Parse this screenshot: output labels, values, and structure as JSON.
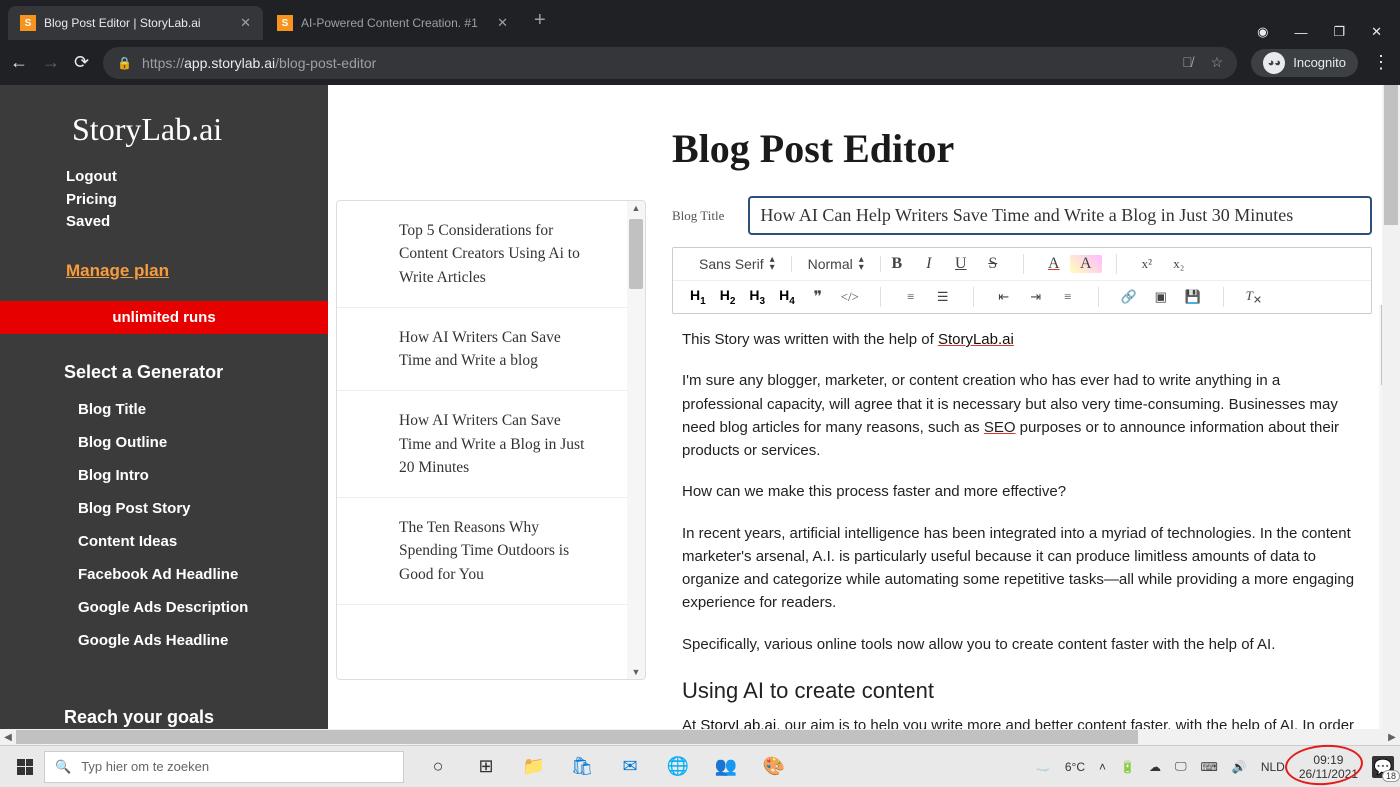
{
  "browser": {
    "tabs": [
      {
        "label": "Blog Post Editor | StoryLab.ai",
        "active": true
      },
      {
        "label": "AI-Powered Content Creation. #1",
        "active": false
      }
    ],
    "url_prefix": "https://",
    "url_host": "app.storylab.ai",
    "url_path": "/blog-post-editor",
    "incognito": "Incognito"
  },
  "sidebar": {
    "logo": "StoryLab.ai",
    "links": [
      "Logout",
      "Pricing",
      "Saved"
    ],
    "manage": "Manage plan",
    "banner": "unlimited runs",
    "gen_head": "Select a Generator",
    "generators": [
      "Blog Title",
      "Blog Outline",
      "Blog Intro",
      "Blog Post Story",
      "Content Ideas",
      "Facebook Ad Headline",
      "Google Ads Description",
      "Google Ads Headline"
    ],
    "goals": "Reach your goals"
  },
  "suggestions": [
    "Top 5 Considerations for Content Creators Using Ai to Write Articles",
    "How AI Writers Can Save Time and Write a blog",
    "How AI Writers Can Save Time and Write a Blog in Just 20 Minutes",
    "The Ten Reasons Why Spending Time Outdoors is Good for You"
  ],
  "editor": {
    "page_title": "Blog Post Editor",
    "title_label": "Blog Title",
    "title_value": "How AI Can Help Writers Save Time and Write a Blog in Just 30 Minutes",
    "font_family": "Sans Serif",
    "font_size": "Normal",
    "body": {
      "intro_prefix": "This Story was written with the help of ",
      "intro_link": "StoryLab.ai",
      "p1a": "I'm sure any blogger, marketer, or content creation who has ever had to write anything in a professional capacity, will agree that it is necessary but also very time-consuming. Businesses may need blog articles for many reasons, such as ",
      "p1_seo": "SEO",
      "p1b": " purposes or to announce information about their products or services.",
      "p2": "How can we make this process faster and more effective?",
      "p3": "In recent years, artificial intelligence has been integrated into a myriad of technologies. In the content marketer's arsenal, A.I. is particularly useful because it can produce limitless amounts of data to organize and categorize while automating some repetitive tasks—all while providing a more engaging experience for readers.",
      "p4": "Specifically, various online tools now allow you to create content faster with the help of AI.",
      "h3": "Using AI to create content",
      "p5a": "At ",
      "p5_link": "StoryLab.ai",
      "p5b": ", our aim is to help you write more and better content faster, with the help of AI. In order"
    }
  },
  "taskbar": {
    "search_placeholder": "Typ hier om te zoeken",
    "weather": "6°C",
    "lang": "NLD",
    "time": "09:19",
    "date": "26/11/2021",
    "notif_count": "18"
  }
}
